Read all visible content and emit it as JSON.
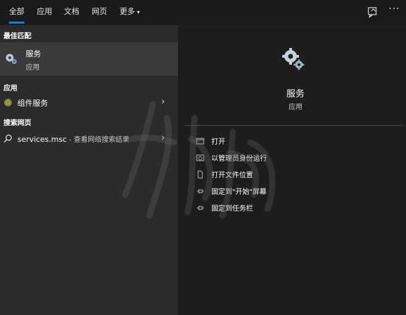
{
  "tabs": [
    {
      "label": "全部"
    },
    {
      "label": "应用"
    },
    {
      "label": "文档"
    },
    {
      "label": "网页"
    },
    {
      "label": "更多"
    }
  ],
  "more_arrow": "▾",
  "more_menu": "···",
  "left": {
    "best_match_title": "最佳匹配",
    "best_match": {
      "name": "服务",
      "type": "应用"
    },
    "apps_title": "应用",
    "apps": [
      {
        "name": "组件服务"
      }
    ],
    "web_title": "搜索网页",
    "web": {
      "query": "services.msc",
      "suffix": " - 查看网络搜索结果"
    }
  },
  "right": {
    "title": "服务",
    "subtitle": "应用",
    "actions": [
      {
        "label": "打开"
      },
      {
        "label": "以管理员身份运行"
      },
      {
        "label": "打开文件位置"
      },
      {
        "label": "固定到\"开始\"屏幕"
      },
      {
        "label": "固定到任务栏"
      }
    ]
  },
  "colors": {
    "accent": "#0a84d6",
    "selected": "#3a3a3a"
  }
}
